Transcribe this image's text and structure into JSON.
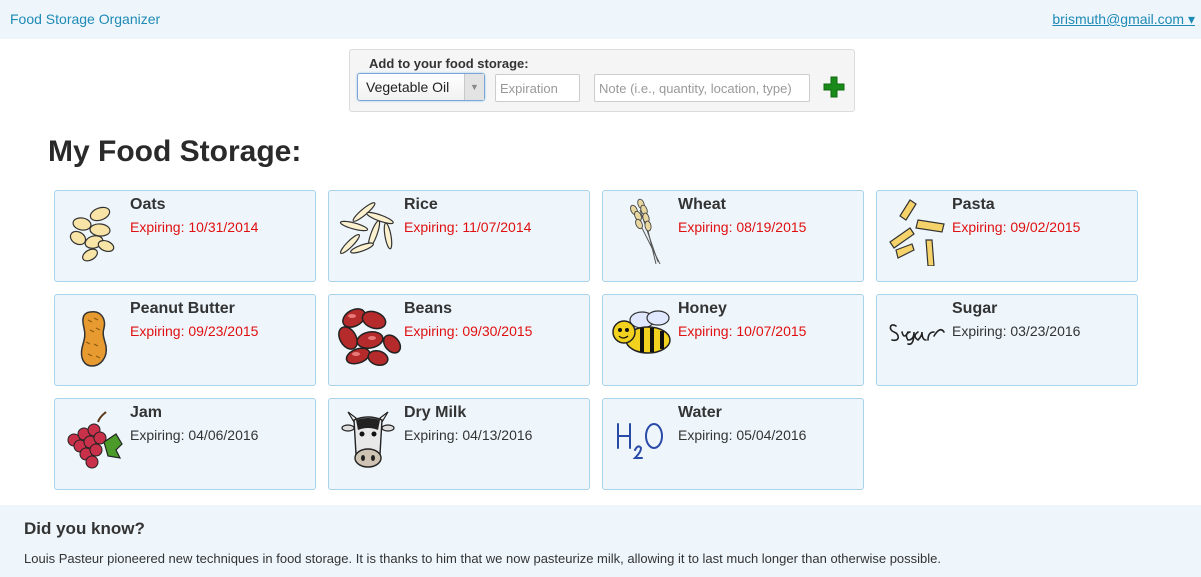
{
  "header": {
    "app_title": "Food Storage Organizer",
    "user_menu": "brismuth@gmail.com ▾"
  },
  "add_form": {
    "title": "Add to your food storage:",
    "selected_food": "Vegetable Oil",
    "expiration_placeholder": "Expiration",
    "note_placeholder": "Note (i.e., quantity, location, type)",
    "add_icon": "plus-icon",
    "add_color": "#1a8a1a"
  },
  "main": {
    "title": "My Food Storage:"
  },
  "storage_items": [
    {
      "name": "Oats",
      "expiration": "Expiring: 10/31/2014",
      "icon": "oats-icon",
      "status": "soon"
    },
    {
      "name": "Rice",
      "expiration": "Expiring: 11/07/2014",
      "icon": "rice-icon",
      "status": "soon"
    },
    {
      "name": "Wheat",
      "expiration": "Expiring: 08/19/2015",
      "icon": "wheat-icon",
      "status": "soon"
    },
    {
      "name": "Pasta",
      "expiration": "Expiring: 09/02/2015",
      "icon": "pasta-icon",
      "status": "soon"
    },
    {
      "name": "Peanut Butter",
      "expiration": "Expiring: 09/23/2015",
      "icon": "peanut-icon",
      "status": "soon"
    },
    {
      "name": "Beans",
      "expiration": "Expiring: 09/30/2015",
      "icon": "beans-icon",
      "status": "soon"
    },
    {
      "name": "Honey",
      "expiration": "Expiring: 10/07/2015",
      "icon": "bee-icon",
      "status": "soon"
    },
    {
      "name": "Sugar",
      "expiration": "Expiring: 03/23/2016",
      "icon": "sugar-script-icon",
      "status": "ok"
    },
    {
      "name": "Jam",
      "expiration": "Expiring: 04/06/2016",
      "icon": "grapes-icon",
      "status": "ok"
    },
    {
      "name": "Dry Milk",
      "expiration": "Expiring: 04/13/2016",
      "icon": "cow-icon",
      "status": "ok"
    },
    {
      "name": "Water",
      "expiration": "Expiring: 05/04/2016",
      "icon": "h2o-icon",
      "status": "ok"
    }
  ],
  "colors": {
    "expiring_soon": "#e01010",
    "card_background": "#eef6fc",
    "card_border": "#a8d3e8",
    "link": "#1e8ab5"
  },
  "did_you_know": {
    "title": "Did you know?",
    "text": "Louis Pasteur pioneered new techniques in food storage. It is thanks to him that we now pasteurize milk, allowing it to last much longer than otherwise possible."
  }
}
